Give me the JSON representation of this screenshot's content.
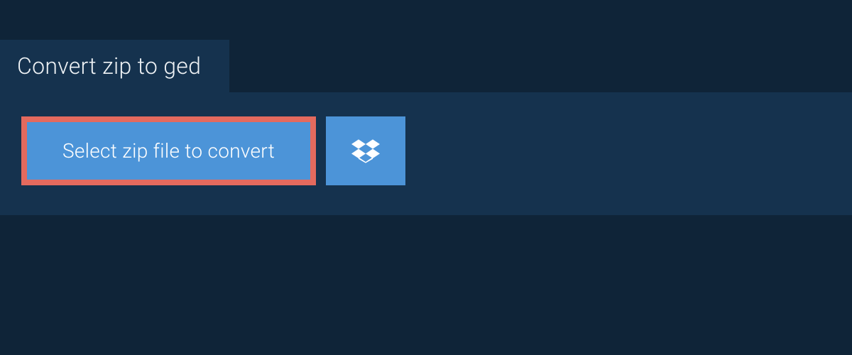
{
  "header": {
    "title": "Convert zip to ged"
  },
  "actions": {
    "select_file_label": "Select zip file to convert",
    "dropbox_icon": "dropbox-icon"
  },
  "colors": {
    "bg_dark": "#0f2438",
    "panel": "#15324e",
    "button_primary": "#4c94d8",
    "button_highlight_border": "#e46a5e",
    "text_light": "#eef2f5"
  }
}
